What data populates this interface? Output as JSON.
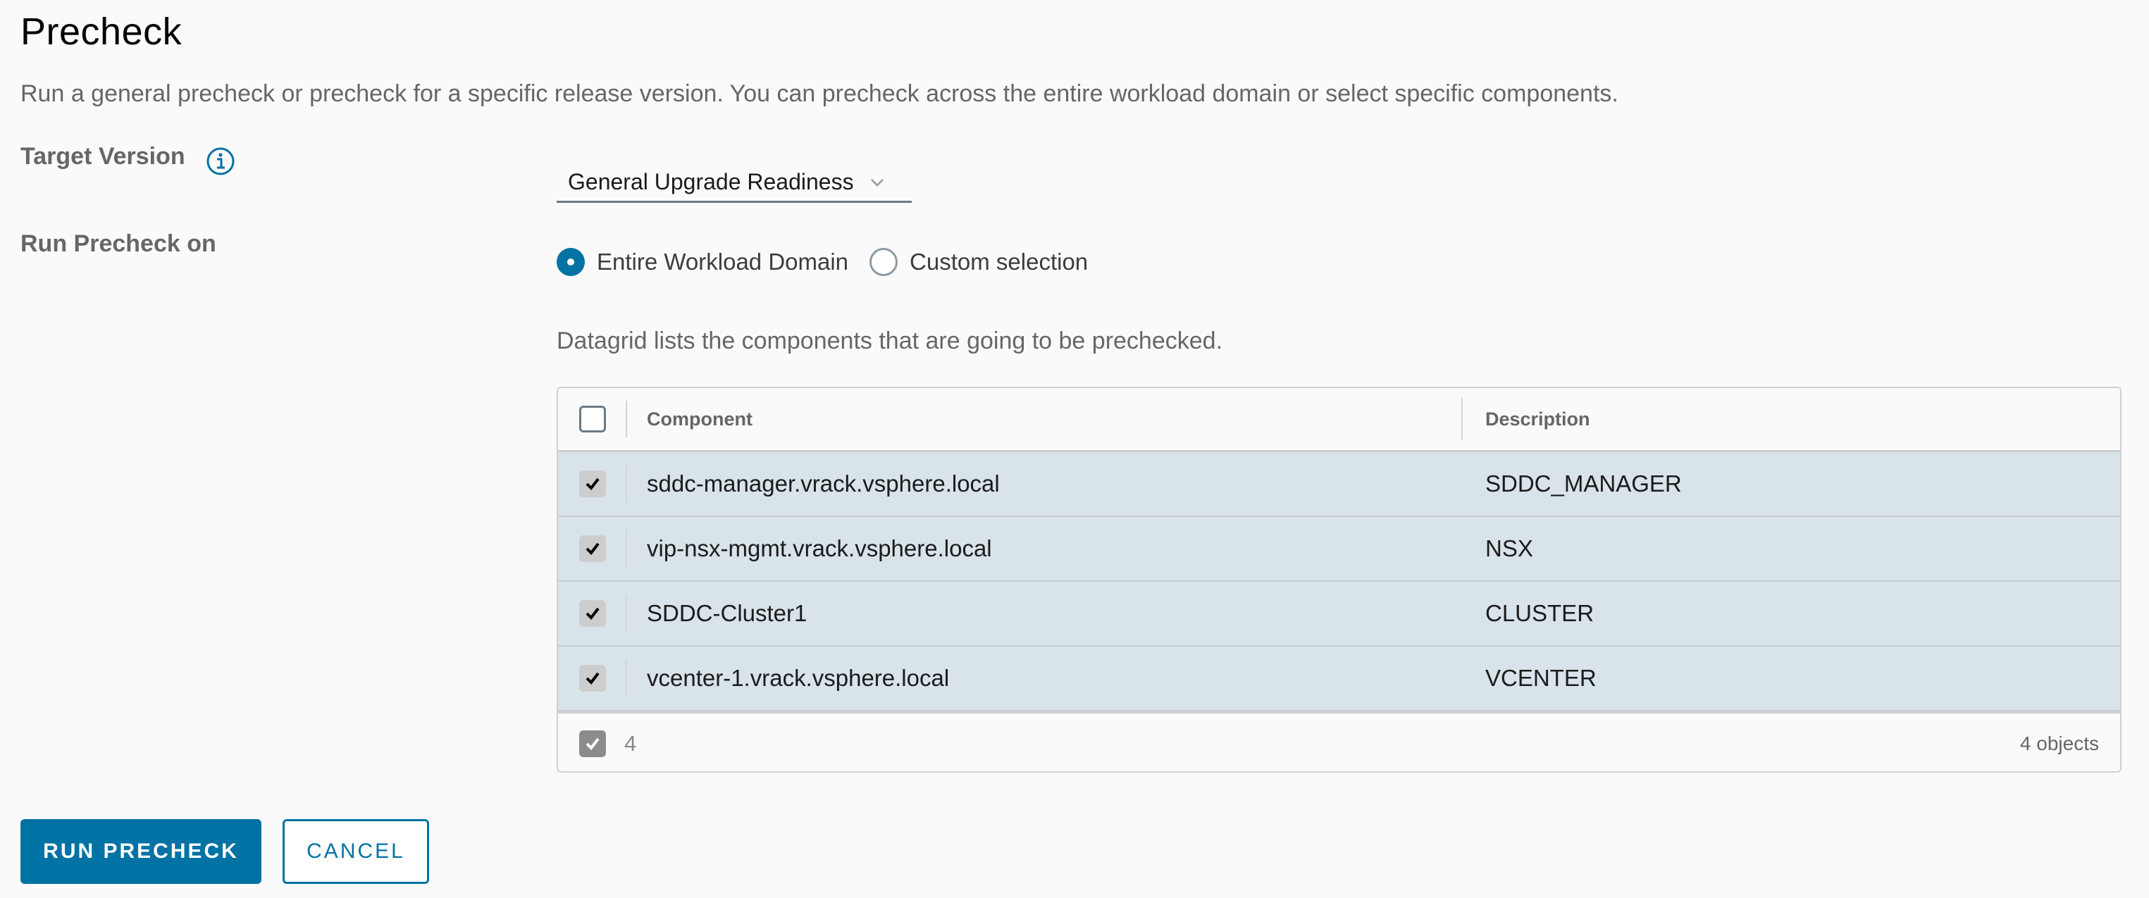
{
  "page": {
    "title": "Precheck",
    "description": "Run a general precheck or precheck for a specific release version. You can precheck across the entire workload domain or select specific components."
  },
  "target_version": {
    "label": "Target Version",
    "info_icon": "info-circle-icon",
    "selected": "General Upgrade Readiness"
  },
  "run_precheck_on": {
    "label": "Run Precheck on",
    "options": [
      {
        "label": "Entire Workload Domain",
        "selected": true
      },
      {
        "label": "Custom selection",
        "selected": false
      }
    ]
  },
  "datagrid": {
    "description": "Datagrid lists the components that are going to be prechecked.",
    "columns": [
      "Component",
      "Description"
    ],
    "rows": [
      {
        "component": "sddc-manager.vrack.vsphere.local",
        "description": "SDDC_MANAGER",
        "checked": true
      },
      {
        "component": "vip-nsx-mgmt.vrack.vsphere.local",
        "description": "NSX",
        "checked": true
      },
      {
        "component": "SDDC-Cluster1",
        "description": "CLUSTER",
        "checked": true
      },
      {
        "component": "vcenter-1.vrack.vsphere.local",
        "description": "VCENTER",
        "checked": true
      }
    ],
    "footer": {
      "selected_count": "4",
      "total": "4 objects"
    }
  },
  "actions": {
    "run_label": "RUN PRECHECK",
    "cancel_label": "CANCEL"
  },
  "colors": {
    "accent": "#0072a3",
    "selected_row": "#d8e3ea"
  }
}
